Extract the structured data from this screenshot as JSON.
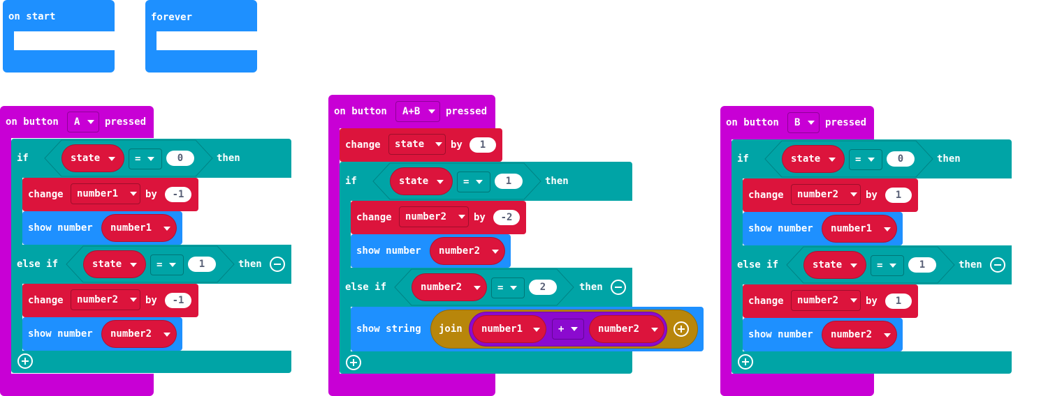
{
  "colors": {
    "events": "#c800d5",
    "basic": "#1e90ff",
    "logic": "#00a4a6",
    "variables": "#dc143c",
    "text": "#b8860b",
    "join_inner": "#8b0acf",
    "number_text": "#575e75"
  },
  "on_start": {
    "label": "on start"
  },
  "forever": {
    "label": "forever"
  },
  "button_a_handler": {
    "prefix": "on button",
    "button": "A",
    "suffix": "pressed",
    "if_label": "if",
    "cond1": {
      "var": "state",
      "op": "=",
      "value": "0"
    },
    "then_label": "then",
    "change1": {
      "label": "change",
      "var": "number1",
      "by": "by",
      "value": "-1"
    },
    "show1": {
      "label": "show number",
      "var": "number1"
    },
    "elseif_label": "else if",
    "cond2": {
      "var": "state",
      "op": "=",
      "value": "1"
    },
    "then2_label": "then",
    "change2": {
      "label": "change",
      "var": "number2",
      "by": "by",
      "value": "-1"
    },
    "show2": {
      "label": "show number",
      "var": "number2"
    }
  },
  "button_ab_handler": {
    "prefix": "on button",
    "button": "A+B",
    "suffix": "pressed",
    "change0": {
      "label": "change",
      "var": "state",
      "by": "by",
      "value": "1"
    },
    "if_label": "if",
    "cond1": {
      "var": "state",
      "op": "=",
      "value": "1"
    },
    "then_label": "then",
    "change1": {
      "label": "change",
      "var": "number2",
      "by": "by",
      "value": "-2"
    },
    "show1": {
      "label": "show number",
      "var": "number2"
    },
    "elseif_label": "else if",
    "cond2": {
      "var": "number2",
      "op": "=",
      "value": "2"
    },
    "then2_label": "then",
    "show_string": {
      "label": "show string",
      "join": "join",
      "left": "number1",
      "op": "+",
      "right": "number2"
    }
  },
  "button_b_handler": {
    "prefix": "on button",
    "button": "B",
    "suffix": "pressed",
    "if_label": "if",
    "cond1": {
      "var": "state",
      "op": "=",
      "value": "0"
    },
    "then_label": "then",
    "change1": {
      "label": "change",
      "var": "number2",
      "by": "by",
      "value": "1"
    },
    "show1": {
      "label": "show number",
      "var": "number1"
    },
    "elseif_label": "else if",
    "cond2": {
      "var": "state",
      "op": "=",
      "value": "1"
    },
    "then2_label": "then",
    "change2": {
      "label": "change",
      "var": "number2",
      "by": "by",
      "value": "1"
    },
    "show2": {
      "label": "show number",
      "var": "number2"
    }
  }
}
